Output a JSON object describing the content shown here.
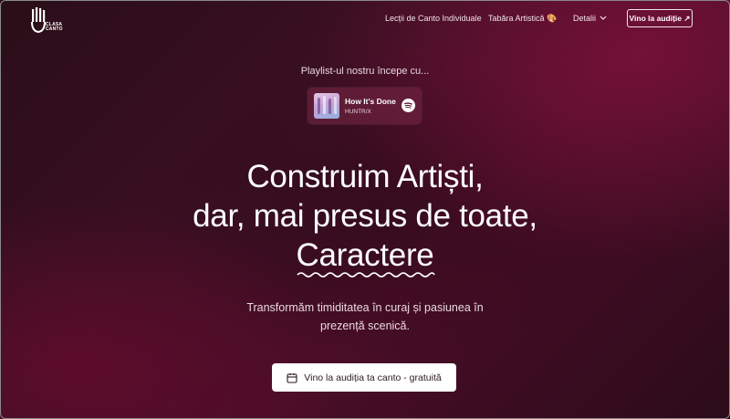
{
  "logo": {
    "line1": "CLASA",
    "line2": "CANTO"
  },
  "nav": {
    "links": [
      "Lecții de Canto Individuale",
      "Tabăra Artistică 🎨",
      "Detalii"
    ],
    "cta": "Vino la audiție ↗"
  },
  "playlist": {
    "caption": "Playlist-ul nostru începe cu...",
    "track": "How It's Done",
    "artist": "HUNTR/X",
    "service_icon": "spotify-icon"
  },
  "hero": {
    "line1": "Construim Artiști,",
    "line2": "dar, mai presus de toate,",
    "line3": "Caractere",
    "sub_line1": "Transformăm timiditatea în curaj și pasiunea în",
    "sub_line2": "prezență scenică.",
    "cta": "Vino la audiția ta canto - gratuită"
  },
  "colors": {
    "accent_bg": "#3a0f22",
    "button_bg": "#ffffff"
  }
}
